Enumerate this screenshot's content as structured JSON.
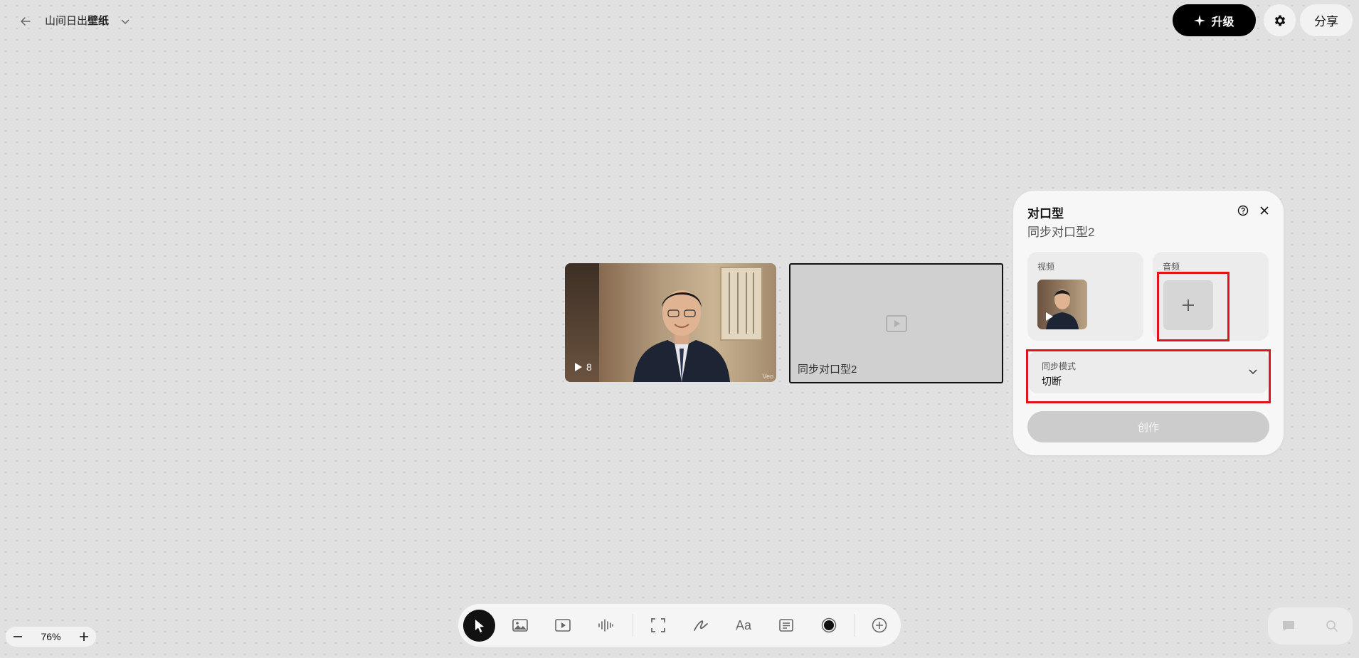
{
  "header": {
    "back_icon": "arrow-left-icon",
    "title_part1": "山间日出",
    "title_part2": "壁纸",
    "upgrade_label": "升级",
    "share_label": "分享"
  },
  "canvas": {
    "video_card": {
      "play_count": "8",
      "watermark": "Veo"
    },
    "output_card": {
      "label": "同步对口型2"
    }
  },
  "panel": {
    "title": "对口型",
    "subtitle": "同步对口型2",
    "video_label": "视频",
    "audio_label": "音频",
    "sync_mode_label": "同步模式",
    "sync_mode_value": "切断",
    "create_label": "创作",
    "highlight_color": "#e0151a"
  },
  "zoom": {
    "level": "76%"
  },
  "toolbar": {
    "tools": [
      "pointer-icon",
      "image-icon",
      "video-icon",
      "audio-waveform-icon",
      "frame-icon",
      "pen-icon",
      "text-icon",
      "note-icon",
      "record-icon",
      "add-circle-icon"
    ],
    "active_tool": "pointer-icon"
  },
  "bottom_right": {
    "icons": [
      "chat-icon",
      "search-icon"
    ]
  }
}
